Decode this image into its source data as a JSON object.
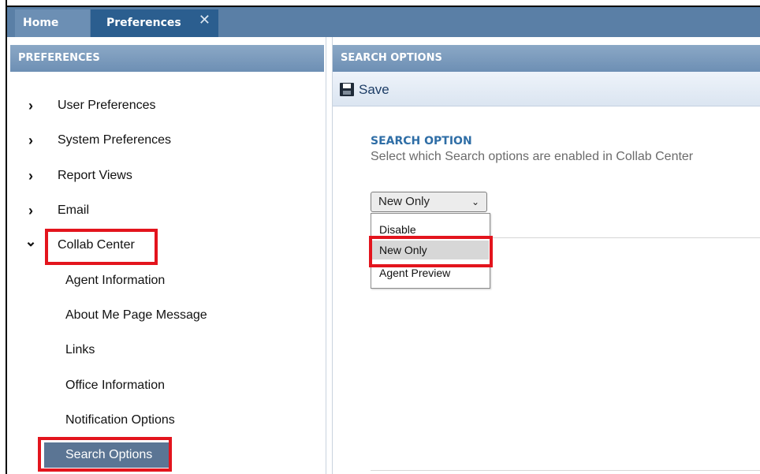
{
  "tabs": {
    "home": "Home",
    "preferences": "Preferences",
    "close": "✕"
  },
  "left_panel": {
    "title": "PREFERENCES",
    "items": [
      {
        "label": "User Preferences",
        "chevron": "›"
      },
      {
        "label": "System Preferences",
        "chevron": "›"
      },
      {
        "label": "Report Views",
        "chevron": "›"
      },
      {
        "label": "Email",
        "chevron": "›"
      },
      {
        "label": "Collab Center",
        "chevron": "⌄"
      }
    ],
    "sub_items": [
      "Agent Information",
      "About Me Page Message",
      "Links",
      "Office Information",
      "Notification Options",
      "Search Options"
    ]
  },
  "right_panel": {
    "title": "SEARCH OPTIONS",
    "save_label": "Save",
    "section_title": "SEARCH OPTION",
    "section_desc": "Select which Search options are enabled in Collab Center",
    "select_value": "New Only",
    "select_arrow": "⌄",
    "options": [
      "Disable",
      "New Only",
      "Agent Preview"
    ]
  },
  "colors": {
    "highlight_box": "#e3141d",
    "header_blue": "#6d8fb4",
    "active_tab": "#2b5e8f",
    "selected_nav": "#5b7594"
  }
}
